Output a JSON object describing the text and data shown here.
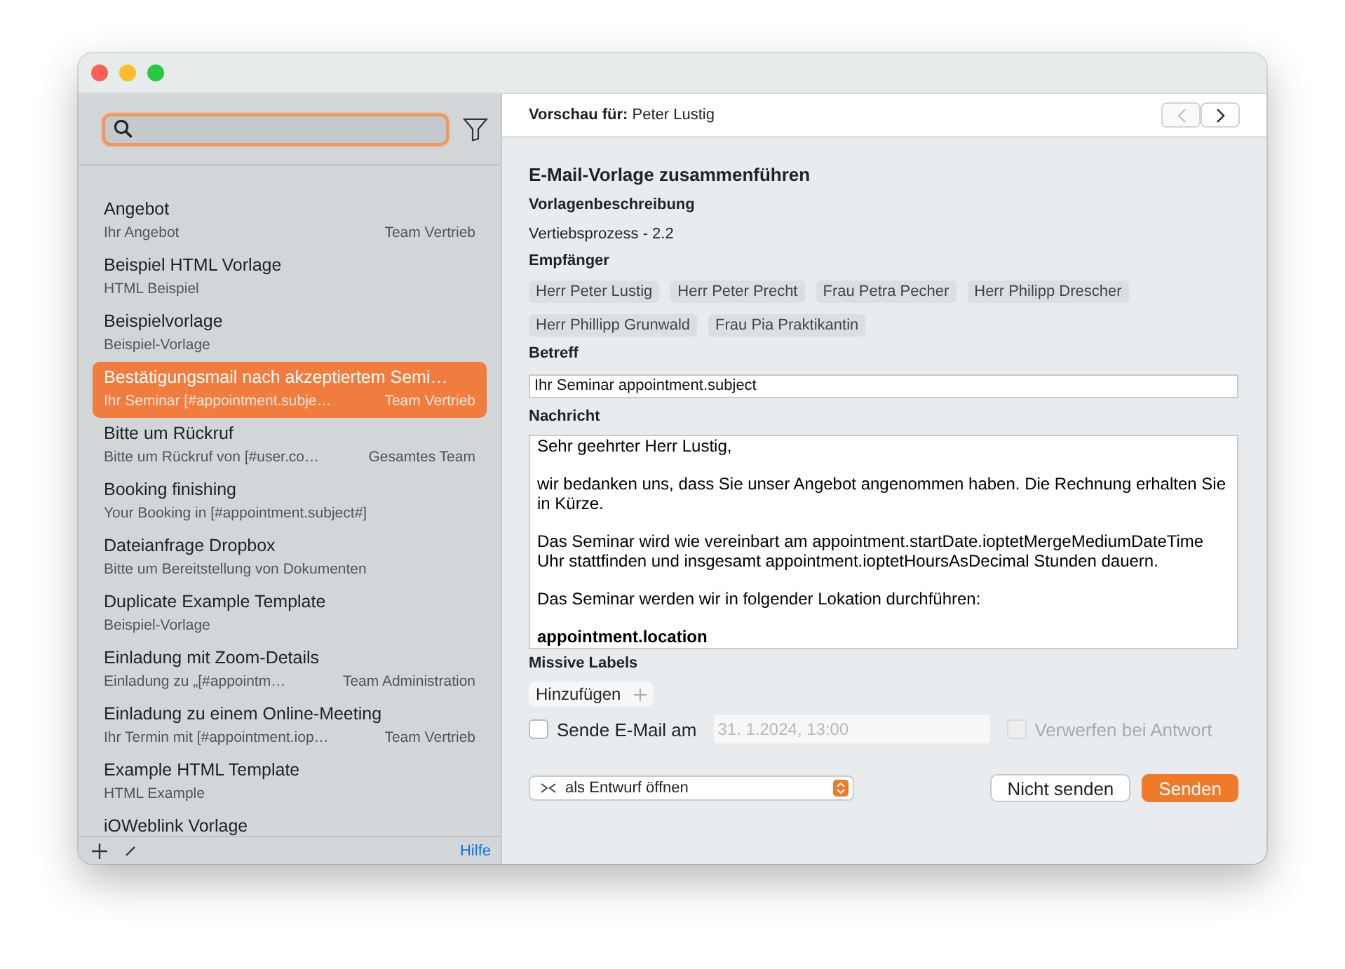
{
  "sidebar": {
    "items": [
      {
        "title": "Angebot",
        "subtitle": "Ihr Angebot",
        "team": "Team Vertrieb",
        "selected": false
      },
      {
        "title": "Beispiel HTML Vorlage",
        "subtitle": "HTML Beispiel",
        "selected": false
      },
      {
        "title": "Beispielvorlage",
        "subtitle": "Beispiel-Vorlage",
        "selected": false
      },
      {
        "title": "Bestätigungsmail nach akzeptiertem Semi…",
        "subtitle": "Ihr Seminar [#appointment.subje…",
        "team": "Team Vertrieb",
        "selected": true
      },
      {
        "title": "Bitte um Rückruf",
        "subtitle": "Bitte um Rückruf von [#user.co…",
        "team": "Gesamtes Team",
        "selected": false
      },
      {
        "title": "Booking finishing",
        "subtitle": "Your Booking in [#appointment.subject#]",
        "selected": false
      },
      {
        "title": "Dateianfrage Dropbox",
        "subtitle": "Bitte um Bereitstellung von Dokumenten",
        "selected": false
      },
      {
        "title": "Duplicate Example Template",
        "subtitle": "Beispiel-Vorlage",
        "selected": false
      },
      {
        "title": "Einladung mit Zoom-Details",
        "subtitle": "Einladung zu „[#appointm…",
        "team": "Team Administration",
        "selected": false
      },
      {
        "title": "Einladung zu einem Online-Meeting",
        "subtitle": "Ihr Termin mit [#appointment.iop…",
        "team": "Team Vertrieb",
        "selected": false
      },
      {
        "title": "Example HTML Template",
        "subtitle": "HTML Example",
        "selected": false
      },
      {
        "title": "iOWeblink Vorlage",
        "selected": false
      }
    ],
    "help": "Hilfe"
  },
  "preview": {
    "label": "Vorschau für:",
    "name": "Peter Lustig",
    "prev_disabled": true,
    "next_disabled": false
  },
  "form": {
    "title": "E-Mail-Vorlage zusammenführen",
    "description_label": "Vorlagenbeschreibung",
    "description": "Vertiebsprozess - 2.2",
    "recipients_label": "Empfänger",
    "recipients": [
      "Herr Peter Lustig",
      "Herr Peter Precht",
      "Frau Petra Pecher",
      "Herr Philipp Drescher",
      "Herr Phillipp Grunwald",
      "Frau Pia Praktikantin"
    ],
    "subject_label": "Betreff",
    "subject": "Ihr Seminar appointment.subject",
    "message_label": "Nachricht",
    "message": [
      "Sehr geehrter Herr Lustig,",
      "wir bedanken uns, dass Sie unser Angebot angenommen haben. Die Rechnung erhalten Sie in Kürze.",
      "Das Seminar wird wie vereinbart am appointment.startDate.ioptetMergeMediumDateTime Uhr stattfinden und insgesamt appointment.ioptetHoursAsDecimal Stunden dauern.",
      "Das Seminar werden wir in folgender Lokation durchführen:",
      "**appointment.location**"
    ],
    "labels_label": "Missive Labels",
    "add_label": "Hinzufügen",
    "schedule": {
      "label": "Sende E-Mail am",
      "checked": false,
      "date": "31.  1.2024, 13:00",
      "date_disabled": true
    },
    "discard": {
      "label": "Verwerfen bei Antwort",
      "checked": false,
      "disabled": true
    },
    "mode": "als Entwurf öffnen",
    "buttons": [
      {
        "label": "Nicht senden",
        "kind": "secondary"
      },
      {
        "label": "Senden",
        "kind": "primary"
      }
    ]
  }
}
